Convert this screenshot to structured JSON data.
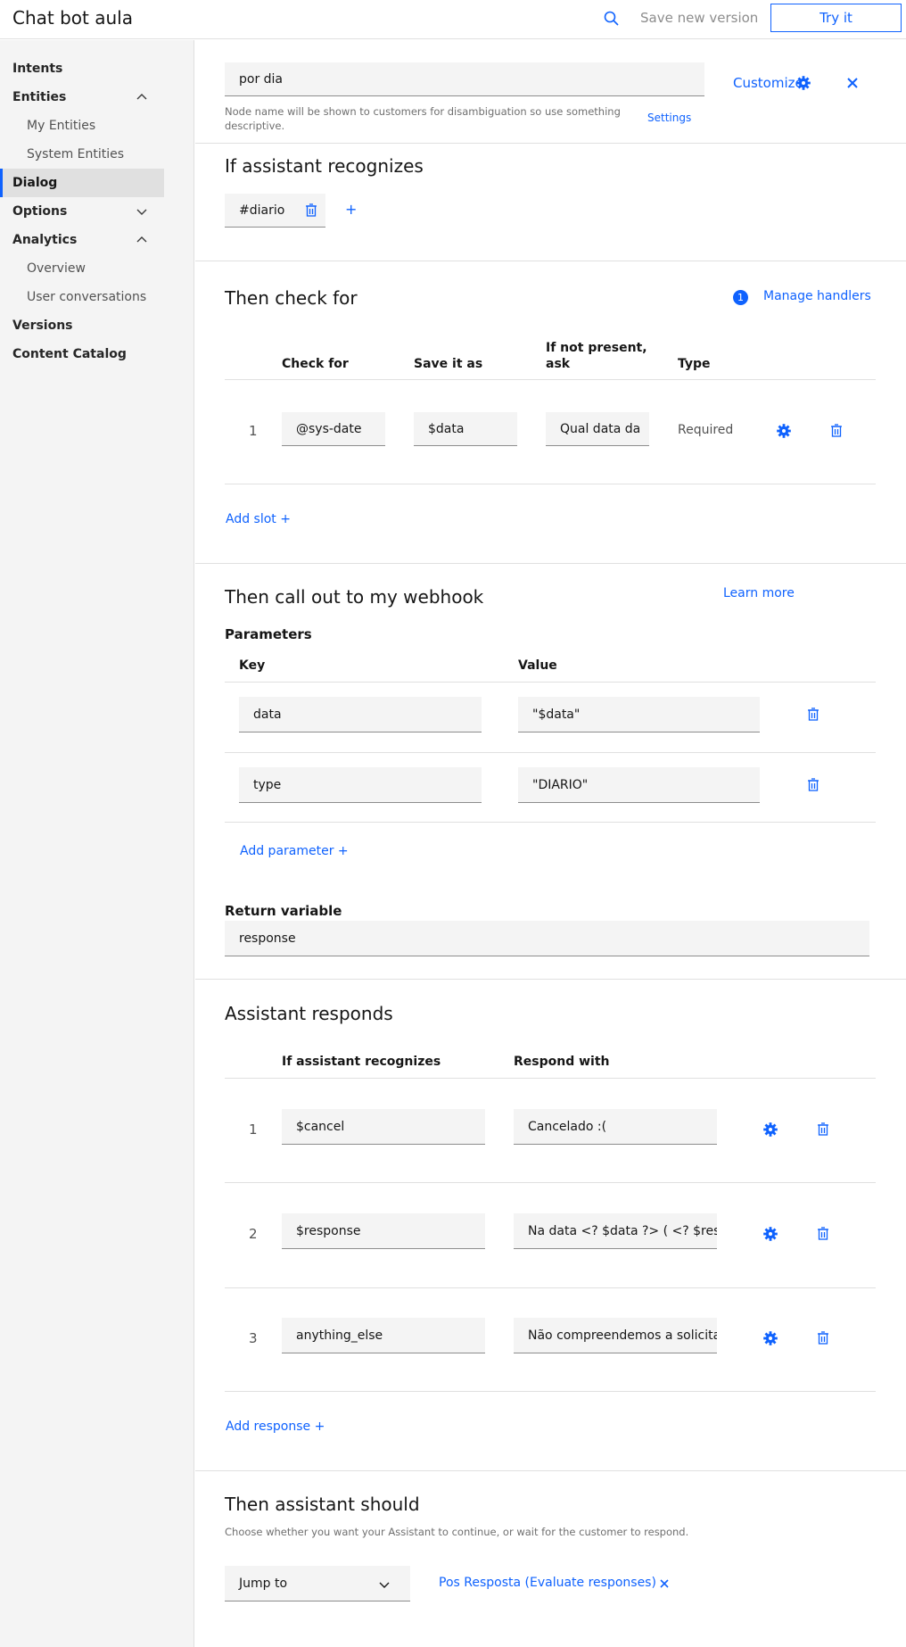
{
  "app": {
    "title": "Chat bot aula",
    "save_version": "Save new version",
    "try_it": "Try it"
  },
  "sidebar": {
    "items": [
      {
        "label": "Intents"
      },
      {
        "label": "Entities"
      },
      {
        "label": "My Entities"
      },
      {
        "label": "System Entities"
      },
      {
        "label": "Dialog"
      },
      {
        "label": "Options"
      },
      {
        "label": "Analytics"
      },
      {
        "label": "Overview"
      },
      {
        "label": "User conversations"
      },
      {
        "label": "Versions"
      },
      {
        "label": "Content Catalog"
      }
    ]
  },
  "node": {
    "name": "por dia",
    "helper": "Node name will be shown to customers for disambiguation so use something descriptive.",
    "settings": "Settings",
    "customize": "Customize"
  },
  "recognizes": {
    "title": "If assistant recognizes",
    "condition": "#diario",
    "add": "+"
  },
  "check": {
    "title": "Then check for",
    "handlers_count": "1",
    "manage_handlers": "Manage handlers",
    "headers": {
      "check_for": "Check for",
      "save_as": "Save it as",
      "if_not_line1": "If not present,",
      "if_not_line2": "ask",
      "type": "Type"
    },
    "slots": [
      {
        "index": "1",
        "check_for": "@sys-date",
        "save_as": "$data",
        "ask": "Qual data da",
        "type": "Required"
      }
    ],
    "add_slot": "Add slot"
  },
  "webhook": {
    "title": "Then call out to my webhook",
    "learn_more": "Learn more",
    "parameters": "Parameters",
    "headers": {
      "key": "Key",
      "value": "Value"
    },
    "params": [
      {
        "key": "data",
        "value": "\"$data\""
      },
      {
        "key": "type",
        "value": "\"DIARIO\""
      }
    ],
    "add_parameter": "Add parameter",
    "return_label": "Return variable",
    "return_value": "response"
  },
  "responds": {
    "title": "Assistant responds",
    "headers": {
      "recognizes": "If assistant recognizes",
      "respond": "Respond with"
    },
    "rows": [
      {
        "index": "1",
        "condition": "$cancel",
        "response": "Cancelado :("
      },
      {
        "index": "2",
        "condition": "$response",
        "response": "Na data  <? $data ?>  ( <? $response"
      },
      {
        "index": "3",
        "condition": "anything_else",
        "response": "Não compreendemos a solicitação"
      }
    ],
    "add_response": "Add response"
  },
  "should": {
    "title": "Then assistant should",
    "helper": "Choose whether you want your Assistant to continue, or wait for the customer to respond.",
    "action": "Jump to",
    "target": "Pos Resposta (Evaluate responses)"
  },
  "colors": {
    "accent": "#0f62fe",
    "field": "#f4f4f4",
    "sidebar": "#f4f4f4"
  }
}
